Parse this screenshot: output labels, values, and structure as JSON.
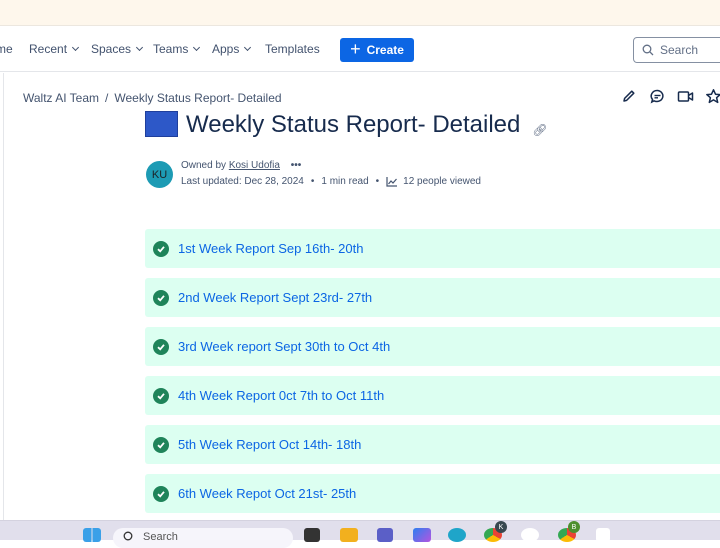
{
  "topnav": {
    "items": [
      {
        "label": "me",
        "has_dropdown": false
      },
      {
        "label": "Recent",
        "has_dropdown": true
      },
      {
        "label": "Spaces",
        "has_dropdown": true
      },
      {
        "label": "Teams",
        "has_dropdown": true
      },
      {
        "label": "Apps",
        "has_dropdown": true
      },
      {
        "label": "Templates",
        "has_dropdown": false
      }
    ],
    "create_label": "Create",
    "search_placeholder": "Search"
  },
  "breadcrumb": {
    "space": "Waltz AI Team",
    "separator": "/",
    "page": "Weekly Status Report- Detailed"
  },
  "page_actions": [
    "edit-icon",
    "comment-icon",
    "video-icon",
    "star-icon"
  ],
  "page": {
    "title": "Weekly Status Report- Detailed",
    "title_emoji": "calendar-icon",
    "owner_prefix": "Owned by",
    "owner_name": "Kosi Udofia",
    "owner_initials": "KU",
    "more": "•••",
    "last_updated": "Last updated: Dec 28, 2024",
    "read_time": "1 min read",
    "views": "12 people viewed",
    "bullet": "•"
  },
  "reports": [
    {
      "label": "1st Week Report Sep 16th- 20th",
      "status": "complete"
    },
    {
      "label": "2nd Week Report Sept 23rd- 27th",
      "status": "complete"
    },
    {
      "label": "3rd Week report Sept 30th to Oct 4th",
      "status": "complete"
    },
    {
      "label": "4th Week Report 0ct 7th to Oct 11th",
      "status": "complete"
    },
    {
      "label": "5th Week Report Oct 14th- 18th",
      "status": "complete"
    },
    {
      "label": "6th Week Repot Oct 21st- 25th",
      "status": "complete"
    }
  ],
  "colors": {
    "accent": "#0c66e4",
    "success_bg": "#dcfff1",
    "success_icon": "#1f845a",
    "avatar": "#1d9bb4"
  },
  "taskbar": {
    "search_placeholder": "Search",
    "badges": [
      "K",
      "B"
    ]
  }
}
